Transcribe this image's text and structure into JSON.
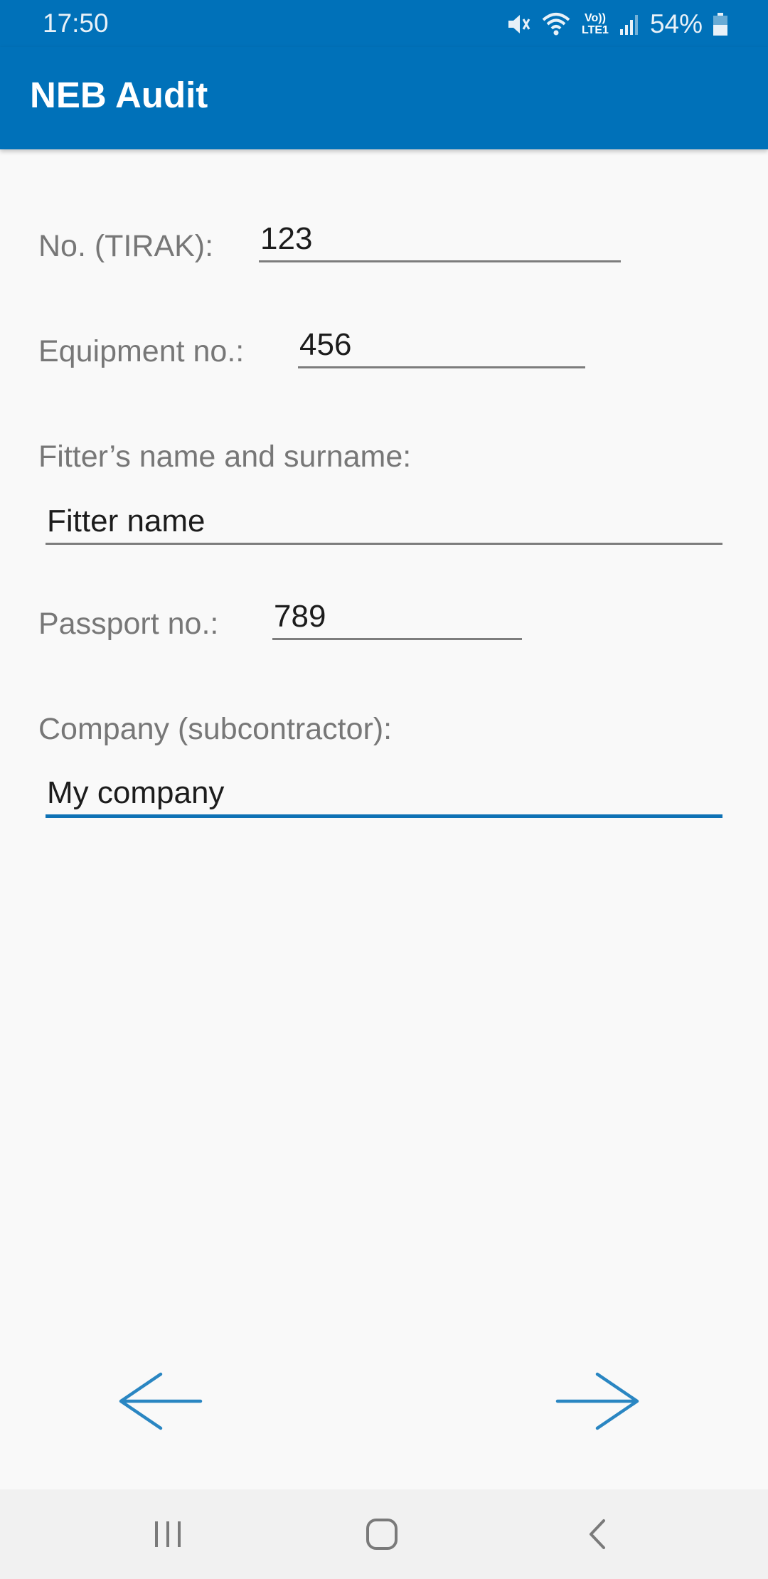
{
  "status_bar": {
    "time": "17:50",
    "battery_percent": "54%",
    "network_label_top": "Vo))",
    "network_label_bottom": "LTE1",
    "icons": [
      "mute-icon",
      "wifi-icon",
      "volte-lte-icon",
      "signal-icon",
      "battery-icon"
    ]
  },
  "app_bar": {
    "title": "NEB Audit"
  },
  "form": {
    "tirak_no": {
      "label": "No. (TIRAK):",
      "value": "123"
    },
    "equipment_no": {
      "label": "Equipment no.:",
      "value": "456"
    },
    "fitter_name": {
      "label": "Fitter’s name and surname:",
      "value": "Fitter name"
    },
    "passport_no": {
      "label": "Passport no.:",
      "value": "789"
    },
    "company": {
      "label": "Company (subcontractor):",
      "value": "My company"
    }
  },
  "navigation": {
    "back_icon": "arrow-left-icon",
    "next_icon": "arrow-right-icon"
  },
  "system_nav": {
    "icons": [
      "recents-icon",
      "home-icon",
      "back-icon"
    ]
  },
  "colors": {
    "primary": "#0071b9",
    "accent": "#0f72b5",
    "arrow": "#2a86c2",
    "background": "#f9f9f9",
    "label": "#777777"
  }
}
